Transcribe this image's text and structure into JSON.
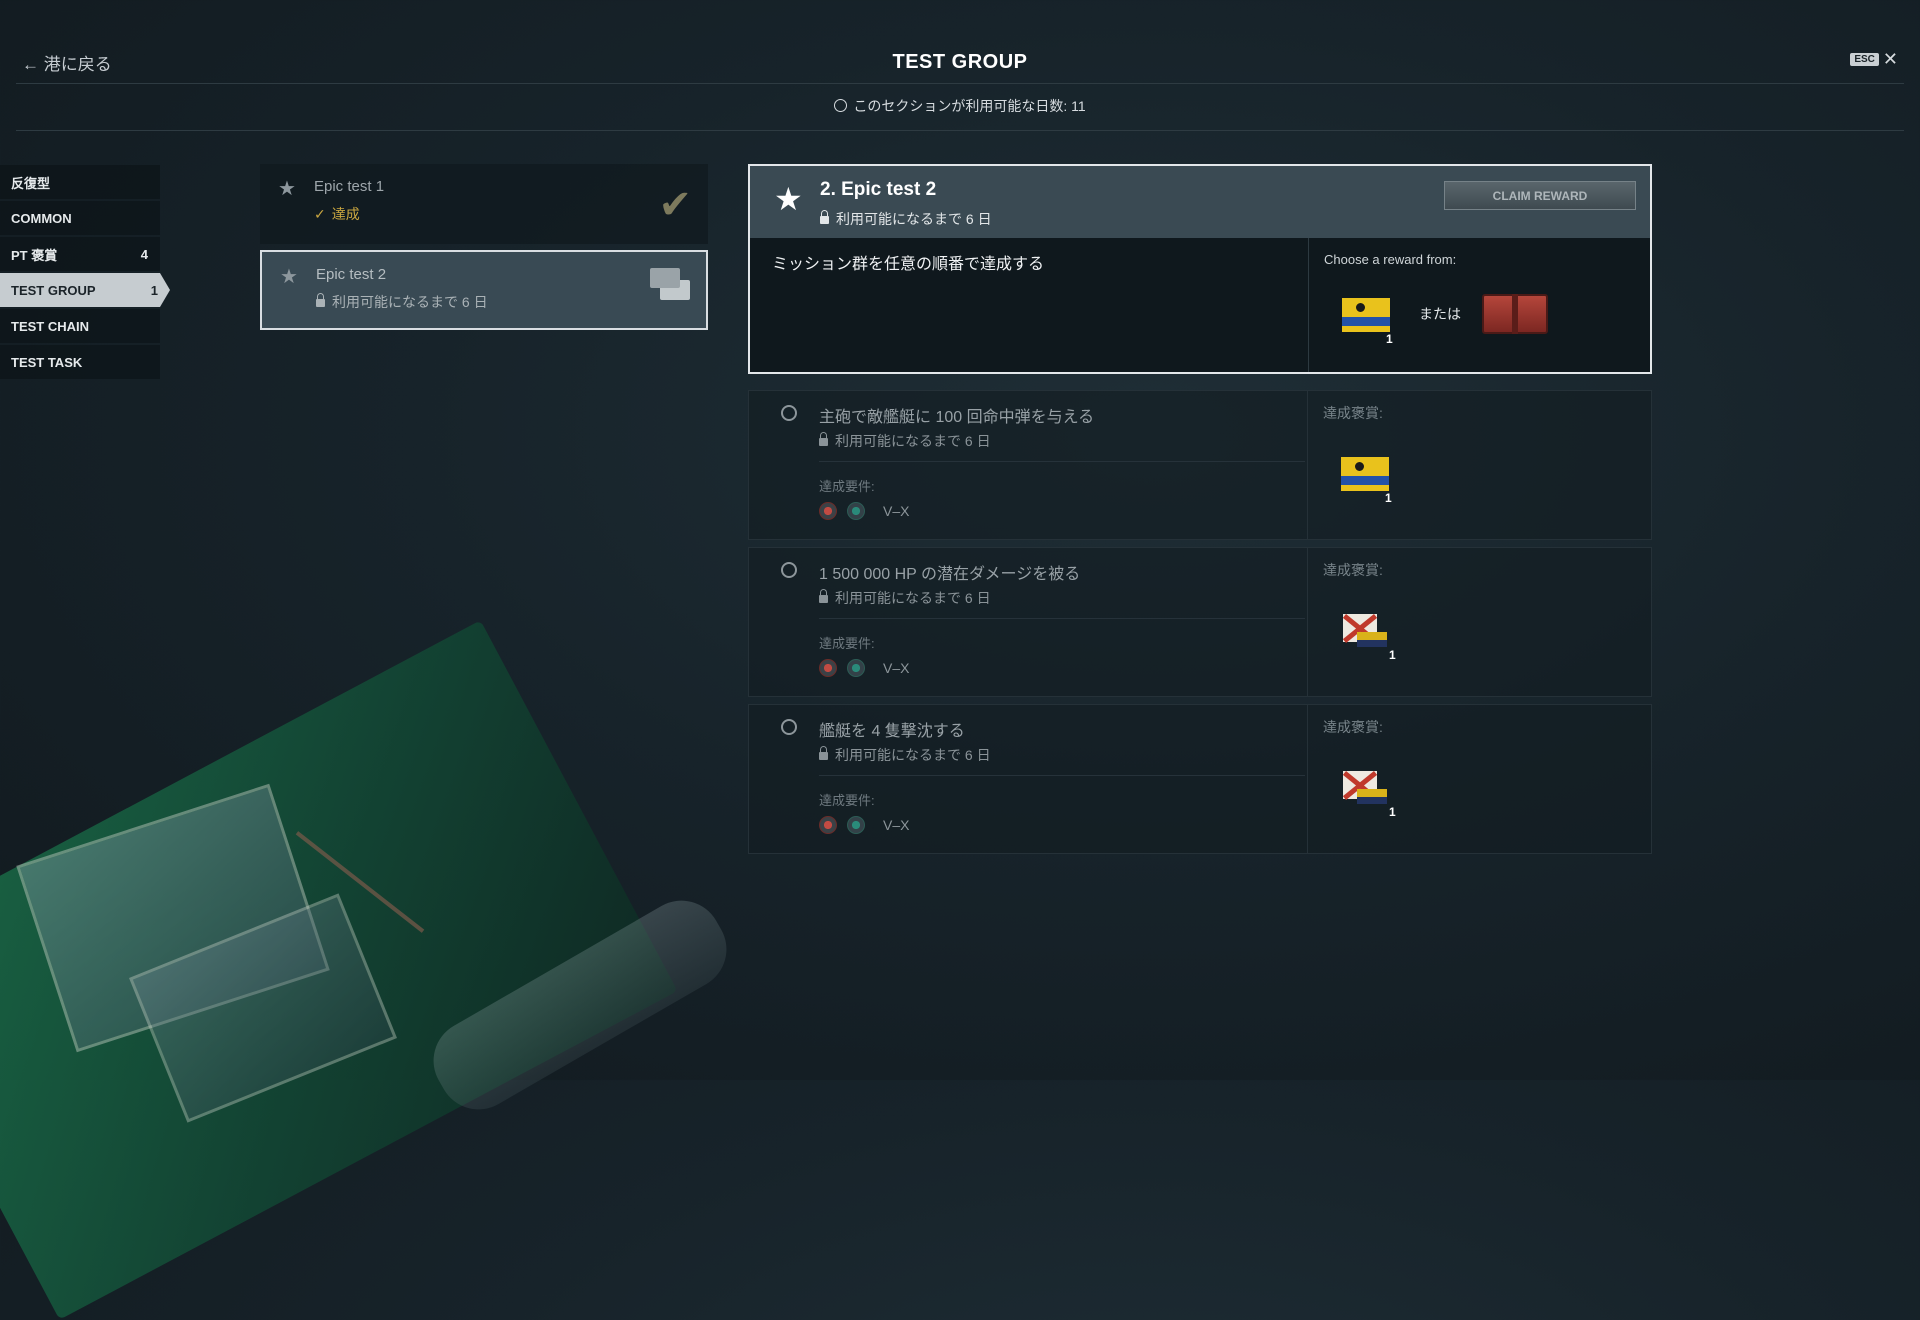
{
  "header": {
    "back_label": "← 港に戻る",
    "title": "TEST GROUP",
    "esc_key": "ESC",
    "close_glyph": "✕",
    "availability": "このセクションが利用可能な日数: 11"
  },
  "sidebar": {
    "items": [
      {
        "label": "反復型",
        "count": ""
      },
      {
        "label": "COMMON",
        "count": ""
      },
      {
        "label": "PT 褒賞",
        "count": "4"
      },
      {
        "label": "TEST GROUP",
        "count": "1"
      },
      {
        "label": "TEST CHAIN",
        "count": ""
      },
      {
        "label": "TEST TASK",
        "count": ""
      }
    ]
  },
  "missions": [
    {
      "name": "Epic test 1",
      "status": "達成",
      "status_icon": "check-icon",
      "reward_icon": "completed-badge-icon"
    },
    {
      "name": "Epic test 2",
      "status": "利用可能になるまで 6 日",
      "status_icon": "lock-icon",
      "reward_icon": "flag-reward-icon"
    }
  ],
  "detail": {
    "title": "2. Epic test 2",
    "lock_text": "利用可能になるまで 6 日",
    "claim_label": "CLAIM REWARD",
    "description": "ミッション群を任意の順番で達成する",
    "choose_label": "Choose a reward from:",
    "or_label": "または",
    "reward_flag_qty": "1",
    "reward_crate_icon": "crate-icon"
  },
  "tasks": [
    {
      "name": "主砲で敵艦艇に 100 回命中弾を与える",
      "lock": "利用可能になるまで 6 日",
      "req_label": "達成要件:",
      "tier": "V–X",
      "reward_label": "達成褒賞:",
      "reward_flag": "yellow-blue-flag",
      "qty": "1"
    },
    {
      "name": "1 500 000 HP の潜在ダメージを被る",
      "lock": "利用可能になるまで 6 日",
      "req_label": "達成要件:",
      "tier": "V–X",
      "reward_label": "達成褒賞:",
      "reward_flag": "red-cross-flag",
      "qty": "1"
    },
    {
      "name": "艦艇を 4 隻撃沈する",
      "lock": "利用可能になるまで 6 日",
      "req_label": "達成要件:",
      "tier": "V–X",
      "reward_label": "達成褒賞:",
      "reward_flag": "red-cross-flag",
      "qty": "1"
    }
  ],
  "colors": {
    "accent_gold": "#c9a640",
    "selected_bg": "#394a54",
    "panel_border": "#e3e7ea"
  }
}
